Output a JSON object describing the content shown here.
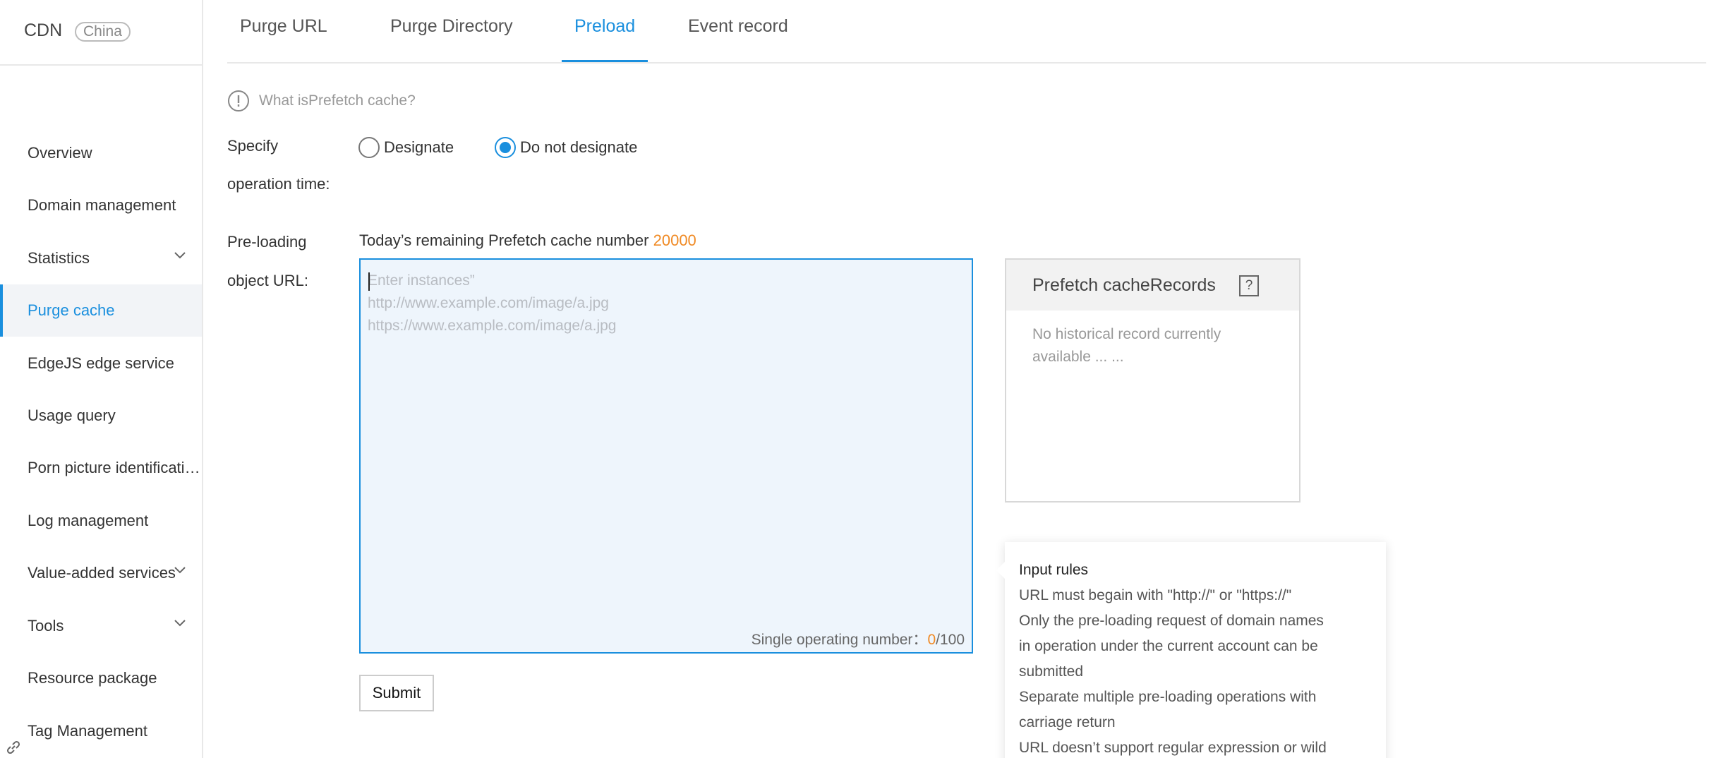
{
  "sidebar": {
    "brand": "CDN",
    "region": "China",
    "items": [
      {
        "label": "Overview"
      },
      {
        "label": "Domain management"
      },
      {
        "label": "Statistics"
      },
      {
        "label": "Purge cache"
      },
      {
        "label": "EdgeJS edge service"
      },
      {
        "label": "Usage query"
      },
      {
        "label": "Porn picture identification"
      },
      {
        "label": "Log management"
      },
      {
        "label": "Value-added services"
      },
      {
        "label": "Tools"
      },
      {
        "label": "Resource package"
      },
      {
        "label": "Tag Management"
      }
    ],
    "active_item": "Purge cache"
  },
  "tabs": [
    {
      "label": "Purge URL"
    },
    {
      "label": "Purge Directory"
    },
    {
      "label": "Preload"
    },
    {
      "label": "Event record"
    }
  ],
  "active_tab": "Preload",
  "info": {
    "link": "What isPrefetch cache?"
  },
  "schedule": {
    "label_line1": "Specify",
    "label_line2": "operation time:",
    "option_designate": "Designate",
    "option_not_designate": "Do not designate",
    "selected": "Do not designate"
  },
  "preload": {
    "label_line1": "Pre-loading",
    "label_line2": "object URL:",
    "remaining_text": "Today’s remaining Prefetch cache number",
    "remaining_value": "20000",
    "placeholder": "Enter instances”\nhttp://www.example.com/image/a.jpg\nhttps://www.example.com/image/a.jpg",
    "value": "",
    "count_label": "Single operating number：",
    "count_current": "0",
    "count_max": "/100",
    "submit_label": "Submit"
  },
  "records": {
    "title": "Prefetch cacheRecords",
    "help": "?",
    "empty": "No historical record currently available ... ..."
  },
  "rules": {
    "title": "Input rules",
    "lines": [
      "URL must begain with \"http://\" or \"https://\"",
      "Only the pre-loading request of domain names",
      "in operation under the current account can be",
      "submitted",
      "Separate multiple pre-loading operations with",
      "carriage return",
      "URL doesn’t support regular expression or wild"
    ]
  },
  "colors": {
    "accent": "#1a8fde",
    "highlight": "#f08a24",
    "input_bg": "#eef5fc"
  }
}
